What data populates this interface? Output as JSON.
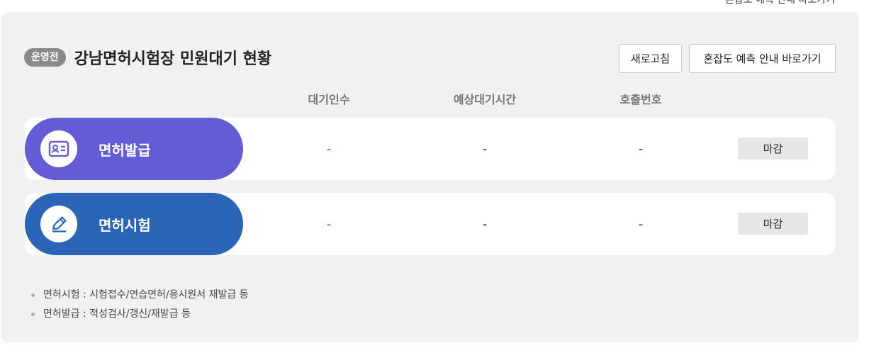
{
  "header": {
    "top_cut_text": "혼잡도 예측 안내 바로가기",
    "badge": "운영전",
    "title": "강남면허시험장 민원대기 현황",
    "refresh_label": "새로고침",
    "forecast_label": "혼잡도 예측 안내 바로가기"
  },
  "columns": [
    "대기인수",
    "예상대기시간",
    "호출번호"
  ],
  "rows": [
    {
      "name": "면허발급",
      "icon": "id-card-icon",
      "waiting": "-",
      "wait_time": "-",
      "call_number": "-",
      "status": "마감"
    },
    {
      "name": "면허시험",
      "icon": "pencil-icon",
      "waiting": "-",
      "wait_time": "-",
      "call_number": "-",
      "status": "마감"
    }
  ],
  "notes": [
    "면허시험 : 시험접수/연습면허/응시원서 재발급 등",
    "면허발급 : 적성검사/갱신/재발급 등"
  ],
  "colors": {
    "purple": "#645bd6",
    "blue": "#2b65b8",
    "panel": "#f1f1f1"
  }
}
